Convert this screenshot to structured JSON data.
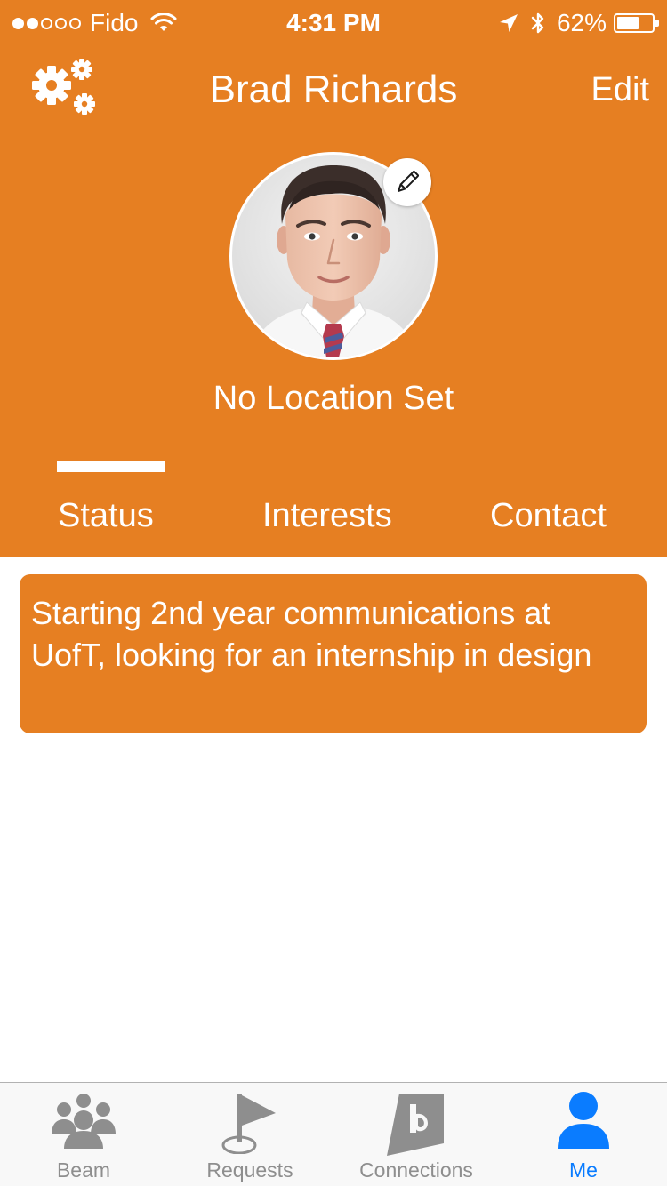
{
  "status_bar": {
    "carrier": "Fido",
    "time": "4:31 PM",
    "battery_percent": "62%",
    "battery_level": 0.62,
    "signal_bars_filled": 2,
    "signal_bars_total": 5
  },
  "nav": {
    "title": "Brad Richards",
    "edit_label": "Edit",
    "settings_icon": "gears-icon"
  },
  "profile": {
    "location": "No Location Set",
    "edit_photo_icon": "pencil-icon"
  },
  "tabs": {
    "items": [
      {
        "label": "Status"
      },
      {
        "label": "Interests"
      },
      {
        "label": "Contact"
      }
    ],
    "selected": "Status"
  },
  "status": {
    "text": "Starting 2nd year communications at UofT, looking for an internship in design"
  },
  "tab_bar": {
    "items": [
      {
        "label": "Beam",
        "icon": "group-icon"
      },
      {
        "label": "Requests",
        "icon": "flag-icon"
      },
      {
        "label": "Connections",
        "icon": "connections-logo-icon"
      },
      {
        "label": "Me",
        "icon": "person-icon"
      }
    ],
    "selected": "Me"
  },
  "colors": {
    "accent": "#E67F22",
    "tab_active": "#0A7CFF",
    "tab_inactive": "#8E8E8E"
  }
}
